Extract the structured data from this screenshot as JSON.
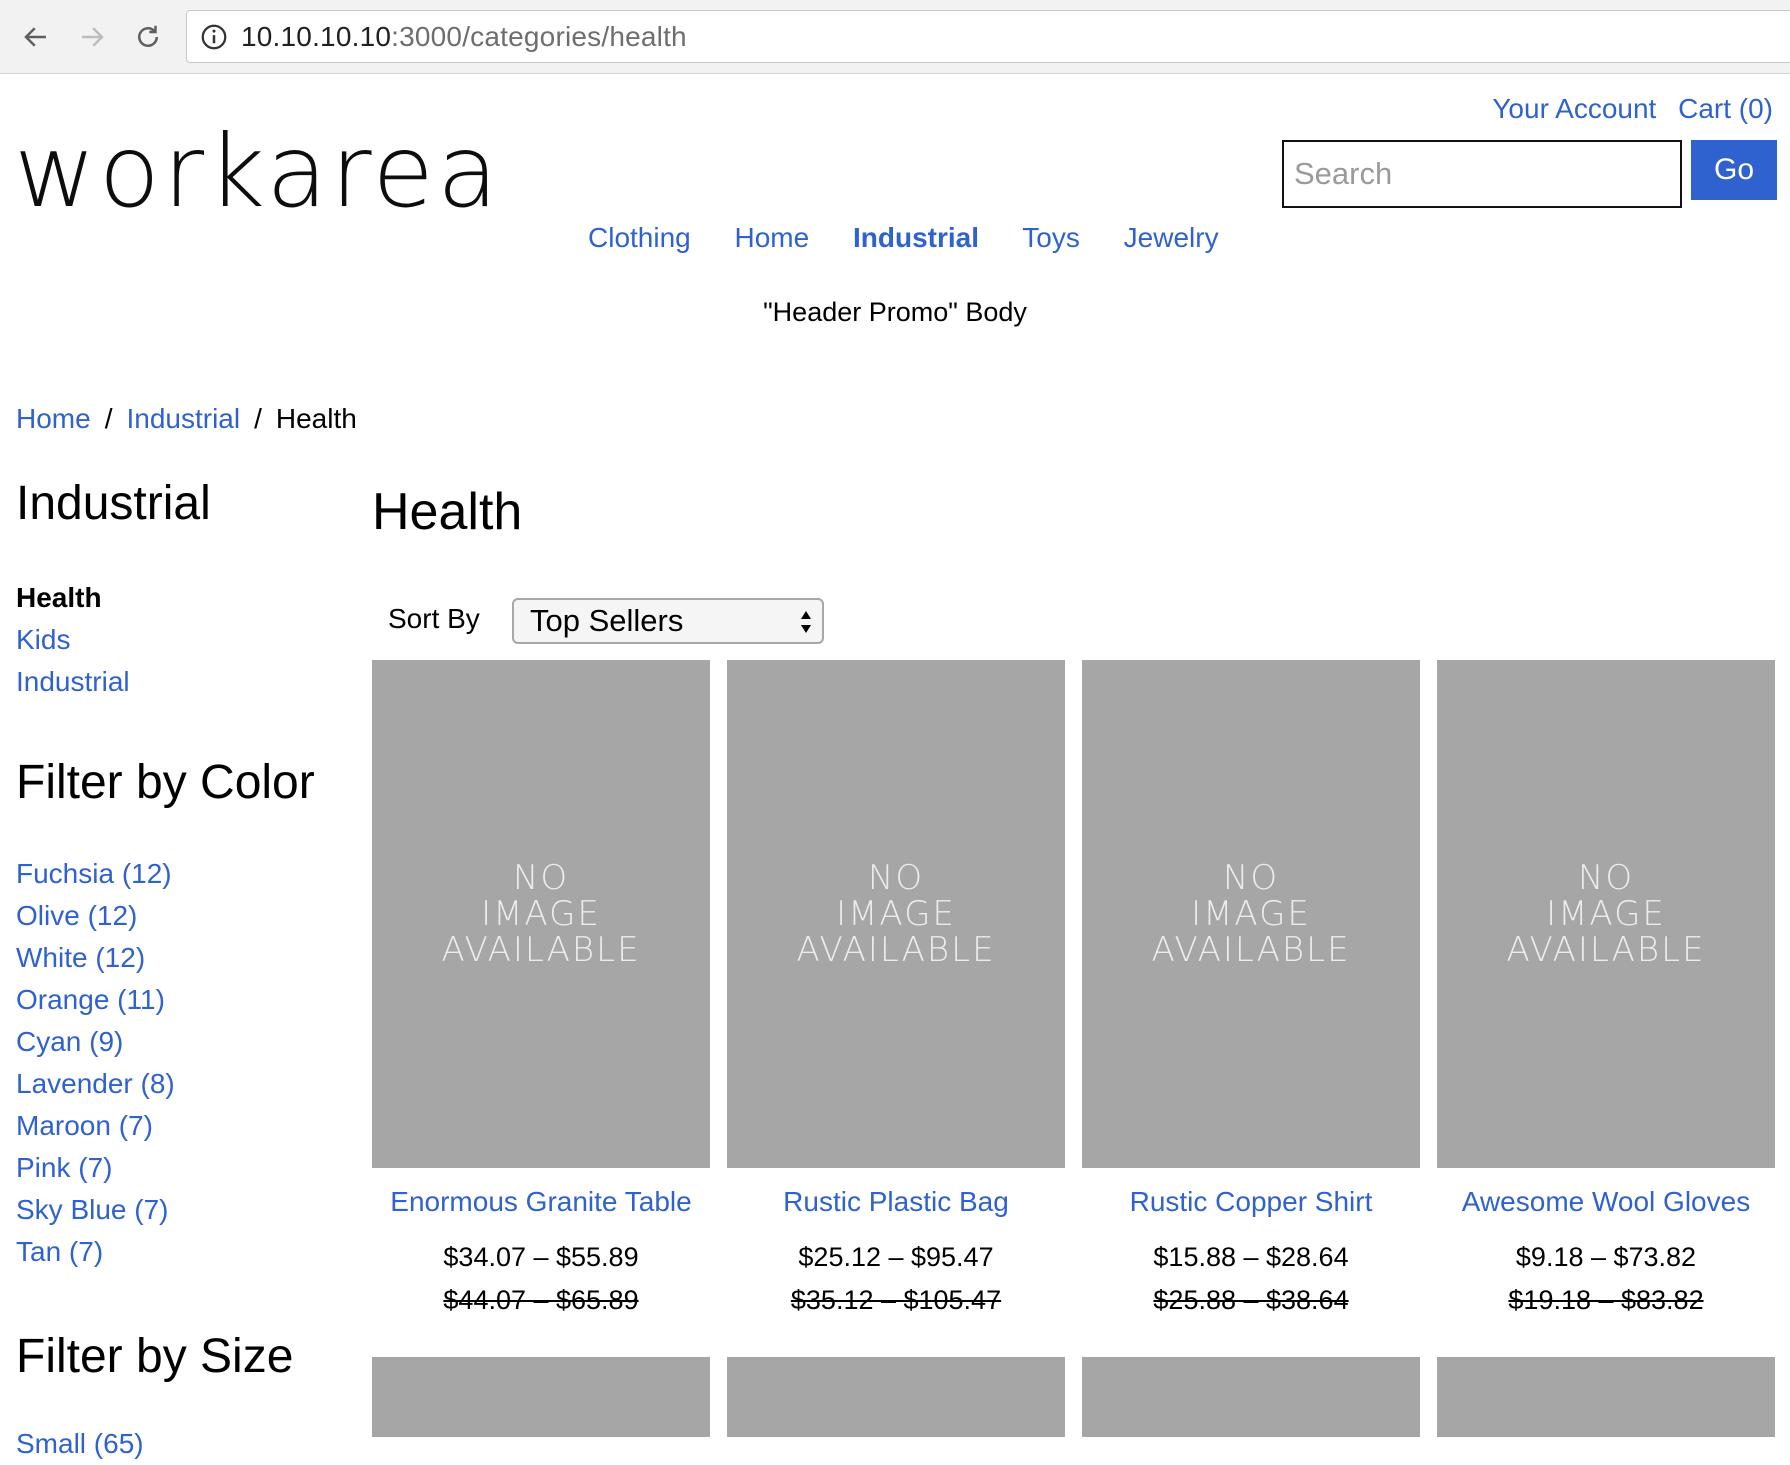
{
  "browser": {
    "url_host": "10.10.10.10",
    "url_rest": ":3000/categories/health"
  },
  "header": {
    "logo": "workarea",
    "your_account": "Your Account",
    "cart": "Cart (0)",
    "search_placeholder": "Search",
    "go": "Go",
    "nav": [
      "Clothing",
      "Home",
      "Industrial",
      "Toys",
      "Jewelry"
    ],
    "nav_active": "Industrial",
    "promo": "\"Header Promo\" Body"
  },
  "breadcrumb": [
    "Home",
    "Industrial",
    "Health"
  ],
  "sidebar": {
    "category_heading": "Industrial",
    "categories": [
      "Health",
      "Kids",
      "Industrial"
    ],
    "color_heading": "Filter by Color",
    "colors": [
      "Fuchsia (12)",
      "Olive (12)",
      "White (12)",
      "Orange (11)",
      "Cyan (9)",
      "Lavender (8)",
      "Maroon (7)",
      "Pink (7)",
      "Sky Blue (7)",
      "Tan (7)"
    ],
    "size_heading": "Filter by Size",
    "sizes": [
      "Small (65)"
    ]
  },
  "main": {
    "title": "Health",
    "sort_label": "Sort By",
    "sort_value": "Top Sellers",
    "no_image_text": "NO\nIMAGE\nAVAILABLE",
    "products": [
      {
        "name": "Enormous Granite Table",
        "price": "$34.07 – $55.89",
        "old_price": "$44.07 – $65.89"
      },
      {
        "name": "Rustic Plastic Bag",
        "price": "$25.12 – $95.47",
        "old_price": "$35.12 – $105.47"
      },
      {
        "name": "Rustic Copper Shirt",
        "price": "$15.88 – $28.64",
        "old_price": "$25.88 – $38.64"
      },
      {
        "name": "Awesome Wool Gloves",
        "price": "$9.18 – $73.82",
        "old_price": "$19.18 – $83.82"
      }
    ]
  },
  "colors": {
    "link": "#2f62cf",
    "button": "#2f62cf",
    "placeholder_image": "#a6a6a6"
  }
}
